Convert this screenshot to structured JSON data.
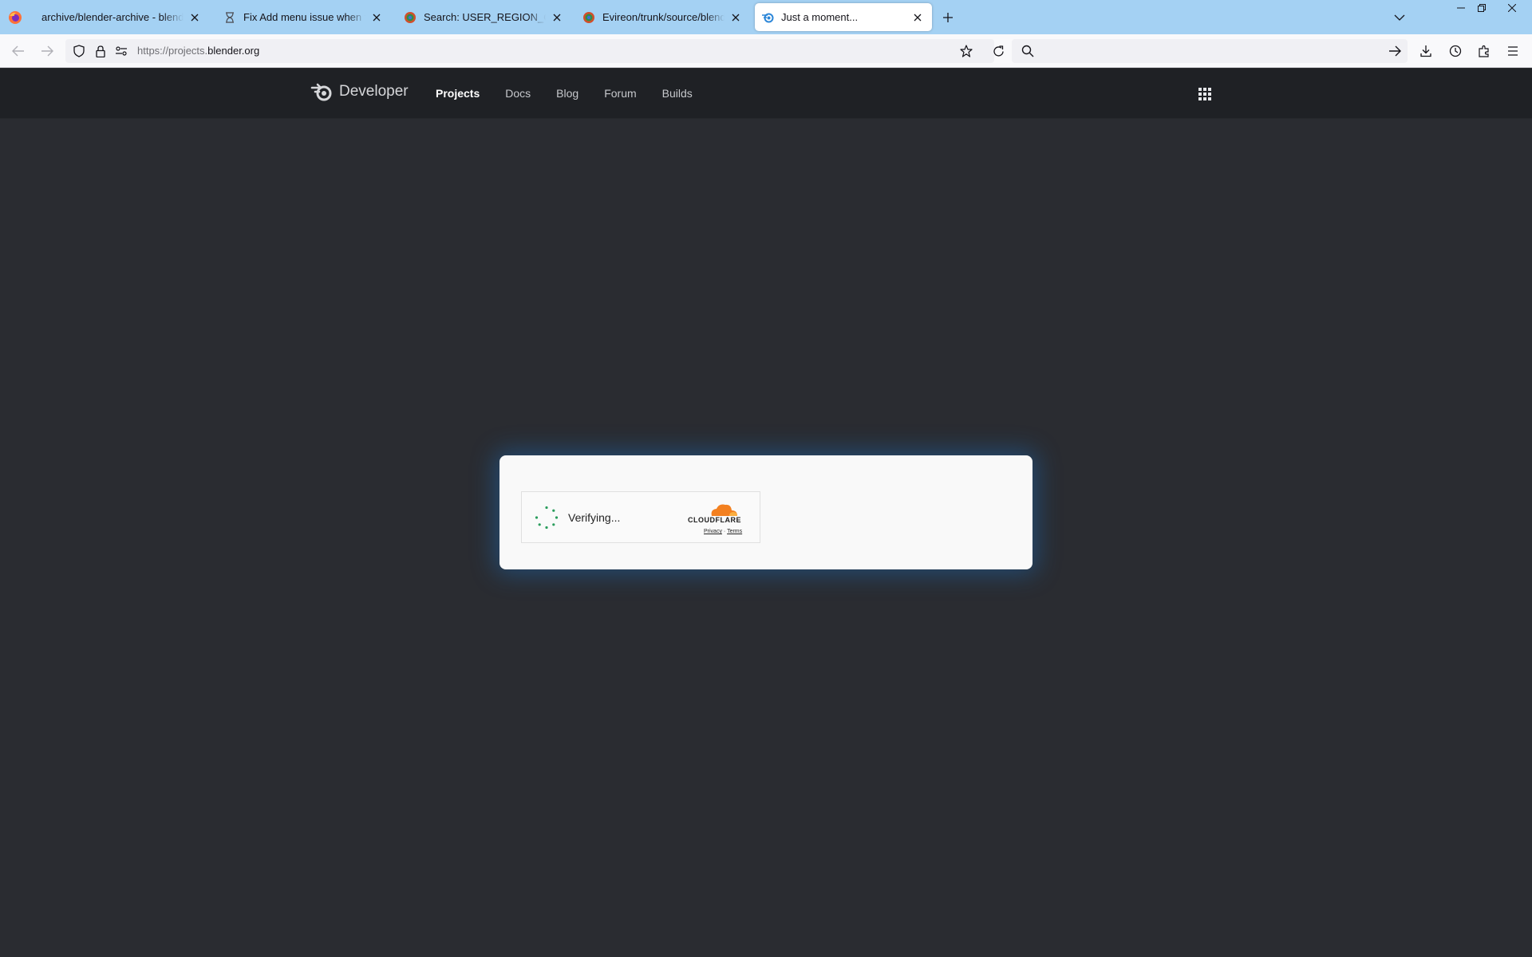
{
  "browser": {
    "tabs": [
      {
        "title": "archive/blender-archive - blender-archive",
        "favicon": "firefox-icon",
        "active": false
      },
      {
        "title": "Fix Add menu issue when there is",
        "favicon": "hourglass-icon",
        "active": false
      },
      {
        "title": "Search: USER_REGION_OVERLAP",
        "favicon": "gitea-icon",
        "active": false
      },
      {
        "title": "Evireon/trunk/source/blender/editors",
        "favicon": "gitea-icon",
        "active": false
      },
      {
        "title": "Just a moment...",
        "favicon": "blender-icon",
        "active": true
      }
    ],
    "url": {
      "prefix": "https://projects.",
      "host": "blender.org"
    },
    "search_placeholder": ""
  },
  "site": {
    "brand": "Developer",
    "nav": [
      {
        "label": "Projects",
        "active": true
      },
      {
        "label": "Docs",
        "active": false
      },
      {
        "label": "Blog",
        "active": false
      },
      {
        "label": "Forum",
        "active": false
      },
      {
        "label": "Builds",
        "active": false
      }
    ]
  },
  "challenge": {
    "status": "Verifying...",
    "provider": "CLOUDFLARE",
    "privacy_label": "Privacy",
    "separator": "·",
    "terms_label": "Terms",
    "colors": {
      "spinner": "#2a9d5c",
      "cloud": "#f38020",
      "glow": "#1c6ebe"
    }
  }
}
